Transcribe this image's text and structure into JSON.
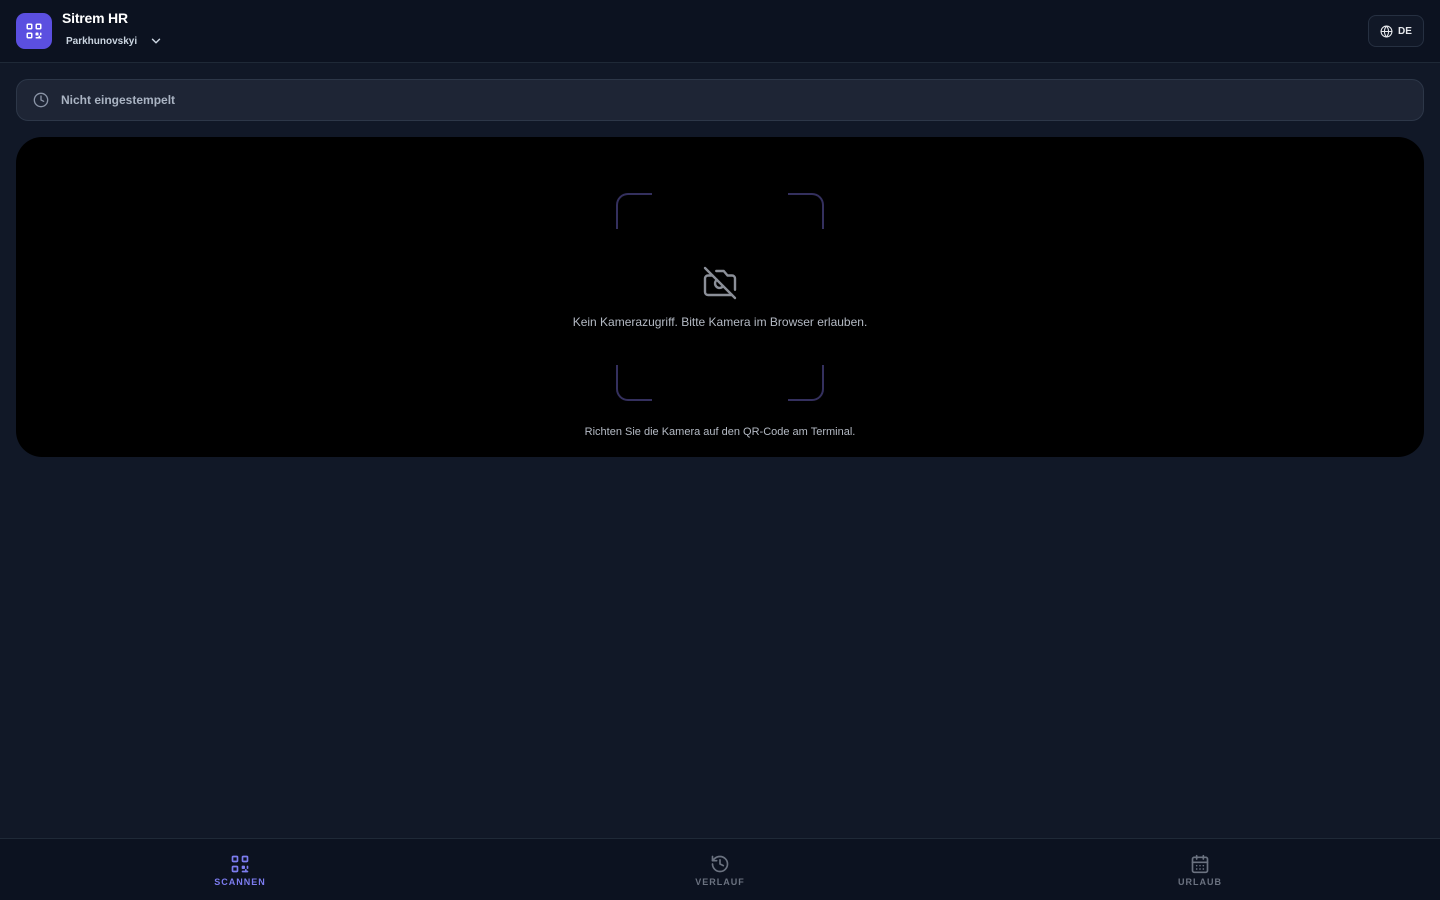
{
  "header": {
    "app_title": "Sitrem HR",
    "user_name": "Parkhunovskyi",
    "language": "DE",
    "logo_icon": "qr-code-icon"
  },
  "status": {
    "text": "Nicht eingestempelt",
    "icon": "clock-icon"
  },
  "camera": {
    "message": "Kein Kamerazugriff. Bitte Kamera im Browser erlauben.",
    "hint": "Richten Sie die Kamera auf den QR-Code am Terminal.",
    "icon": "camera-off-icon"
  },
  "nav": {
    "items": [
      {
        "label": "SCANNEN",
        "icon": "qr-code-icon",
        "active": true
      },
      {
        "label": "VERLAUF",
        "icon": "history-icon",
        "active": false
      },
      {
        "label": "URLAUB",
        "icon": "calendar-icon",
        "active": false
      }
    ]
  },
  "colors": {
    "accent": "#5b4fe0",
    "nav_active": "#7c7cf0",
    "background": "#111827"
  }
}
